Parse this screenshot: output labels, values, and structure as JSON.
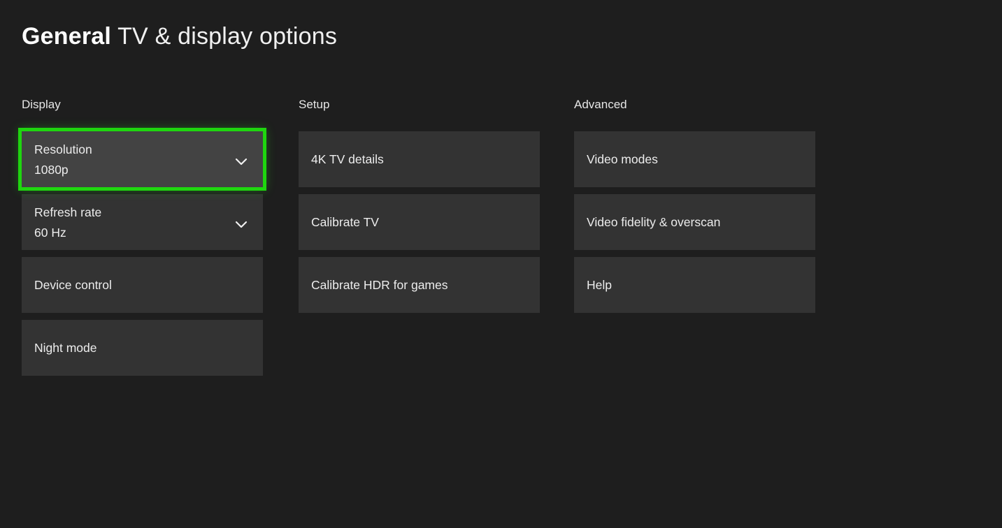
{
  "header": {
    "title_bold": "General",
    "title_rest": "TV & display options"
  },
  "colors": {
    "background": "#1e1e1e",
    "tile": "#333333",
    "tile_focused": "#434343",
    "focus_border": "#1fd60f",
    "text": "#ededed"
  },
  "columns": [
    {
      "id": "display",
      "header": "Display",
      "tiles": [
        {
          "label": "Resolution",
          "value": "1080p",
          "icon": "chevron-down-icon",
          "focused": true
        },
        {
          "label": "Refresh rate",
          "value": "60 Hz",
          "icon": "chevron-down-icon",
          "focused": false
        },
        {
          "label": "Device control",
          "value": null,
          "icon": null,
          "focused": false
        },
        {
          "label": "Night mode",
          "value": null,
          "icon": null,
          "focused": false
        }
      ]
    },
    {
      "id": "setup",
      "header": "Setup",
      "tiles": [
        {
          "label": "4K TV details",
          "value": null,
          "icon": null,
          "focused": false
        },
        {
          "label": "Calibrate TV",
          "value": null,
          "icon": null,
          "focused": false
        },
        {
          "label": "Calibrate HDR for games",
          "value": null,
          "icon": null,
          "focused": false
        }
      ]
    },
    {
      "id": "advanced",
      "header": "Advanced",
      "tiles": [
        {
          "label": "Video modes",
          "value": null,
          "icon": null,
          "focused": false
        },
        {
          "label": "Video fidelity & overscan",
          "value": null,
          "icon": null,
          "focused": false
        },
        {
          "label": "Help",
          "value": null,
          "icon": null,
          "focused": false
        }
      ]
    }
  ]
}
